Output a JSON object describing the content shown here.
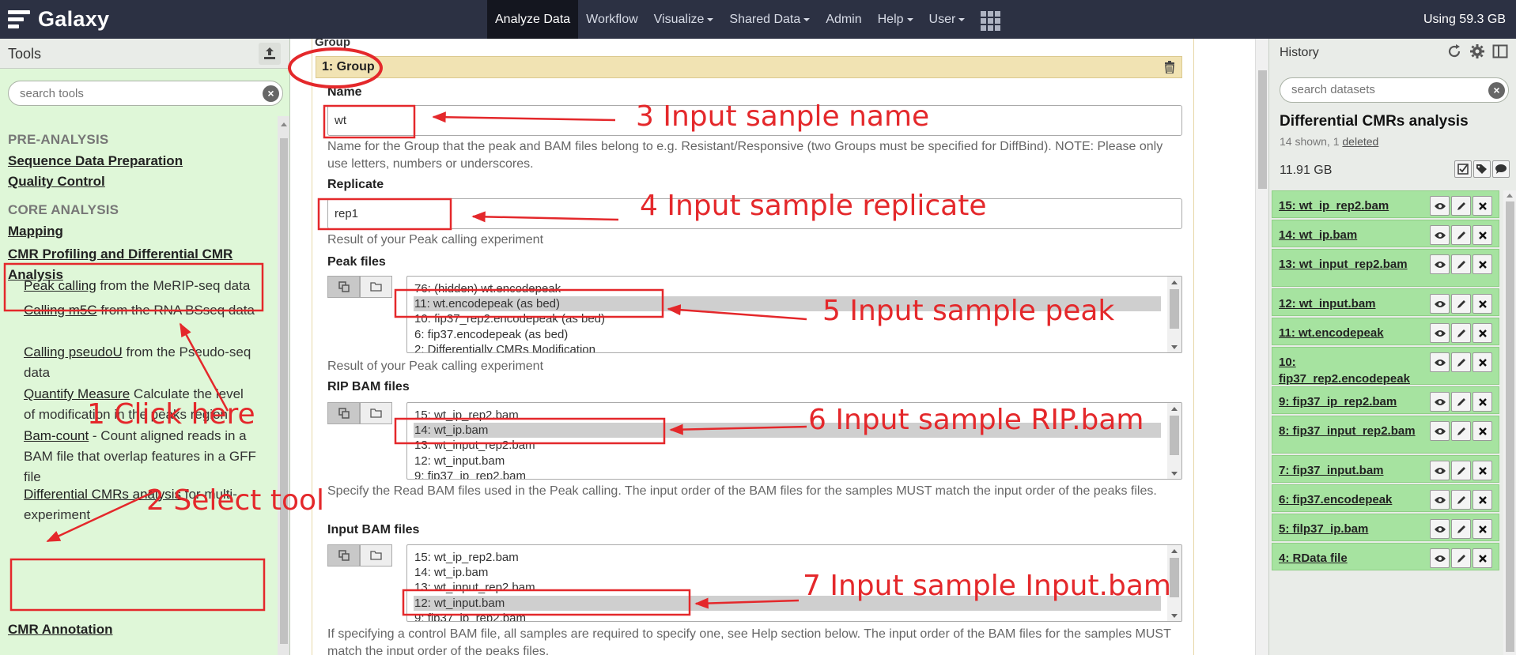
{
  "masthead": {
    "brand": "Galaxy",
    "nav": [
      {
        "label": "Analyze Data",
        "dropdown": false,
        "active": true
      },
      {
        "label": "Workflow",
        "dropdown": false,
        "active": false
      },
      {
        "label": "Visualize",
        "dropdown": true,
        "active": false
      },
      {
        "label": "Shared Data",
        "dropdown": true,
        "active": false
      },
      {
        "label": "Admin",
        "dropdown": false,
        "active": false
      },
      {
        "label": "Help",
        "dropdown": true,
        "active": false
      },
      {
        "label": "User",
        "dropdown": true,
        "active": false
      }
    ],
    "quota": "Using 59.3 GB"
  },
  "tools": {
    "title": "Tools",
    "search_placeholder": "search tools",
    "pre_analysis_header": "PRE-ANALYSIS",
    "sequence_data_prep": "Sequence Data Preparation",
    "quality_control": "Quality Control",
    "core_analysis_header": "CORE ANALYSIS",
    "mapping": "Mapping",
    "cmr_profiling": "CMR Profiling and Differential CMR Analysis",
    "items": [
      {
        "link": "Peak calling",
        "desc": " from the MeRIP-seq data"
      },
      {
        "link": "Calling m5C",
        "desc": " from the RNA BSseq data"
      },
      {
        "link": "Calling pseudoU",
        "desc": " from the Pseudo-seq data"
      },
      {
        "link": "Quantify Measure",
        "desc": " Calculate the level of modification in the peaks region"
      },
      {
        "link": "Bam-count",
        "desc": " - Count aligned reads in a BAM file that overlap features in a GFF file"
      },
      {
        "link": "Differential CMRs analysis",
        "desc": " for multi-experiment"
      }
    ],
    "cmr_annotation": "CMR Annotation"
  },
  "form": {
    "group_section_label": "Group",
    "group_title": "1: Group",
    "name_label": "Name",
    "name_value": "wt",
    "name_help": "Name for the Group that the peak and BAM files belong to e.g. Resistant/Responsive (two Groups must be specified for DiffBind). NOTE: Please only use letters, numbers or underscores.",
    "replicate_label": "Replicate",
    "replicate_value": "rep1",
    "replicate_help": "Result of your Peak calling experiment",
    "peak_label": "Peak files",
    "peak_options": [
      "76: (hidden) wt.encodepeak",
      "11: wt.encodepeak (as bed)",
      "10: fip37_rep2.encodepeak (as bed)",
      "6: fip37.encodepeak (as bed)",
      "2: Differentially CMRs Modification"
    ],
    "peak_selected_index": 1,
    "peak_help": "Result of your Peak calling experiment",
    "rip_label": "RIP BAM files",
    "rip_options": [
      "15: wt_ip_rep2.bam",
      "14: wt_ip.bam",
      "13: wt_input_rep2.bam",
      "12: wt_input.bam",
      "9: fip37_ip_rep2.bam"
    ],
    "rip_selected_index": 1,
    "rip_help": "Specify the Read BAM files used in the Peak calling. The input order of the BAM files for the samples MUST match the input order of the peaks files.",
    "input_label": "Input BAM files",
    "input_options": [
      "15: wt_ip_rep2.bam",
      "14: wt_ip.bam",
      "13: wt_input_rep2.bam",
      "12: wt_input.bam",
      "9: fip37_ip_rep2.bam"
    ],
    "input_selected_index": 3,
    "input_help": "If specifying a control BAM file, all samples are required to specify one, see Help section below. The input order of the BAM files for the samples MUST match the input order of the peaks files."
  },
  "history": {
    "title": "History",
    "search_placeholder": "search datasets",
    "name": "Differential CMRs analysis",
    "shown_prefix": "14 shown, 1 ",
    "deleted_link": "deleted",
    "size": "11.91 GB",
    "datasets": [
      "15: wt_ip_rep2.bam",
      "14: wt_ip.bam",
      "13: wt_input_rep2.bam",
      "12: wt_input.bam",
      "11: wt.encodepeak",
      "10: fip37_rep2.encodepeak",
      "9: fip37_ip_rep2.bam",
      "8: fip37_input_rep2.bam",
      "7: fip37_input.bam",
      "6: fip37.encodepeak",
      "5: filp37_ip.bam",
      "4: RData file"
    ]
  },
  "annotations": {
    "step1": "1 Click here",
    "step2": "2 Select tool",
    "step3": "3 Input sanple name",
    "step4": "4 Input sample replicate",
    "step5": "5 Input sample peak",
    "step6": "6 Input sample RIP.bam",
    "step7": "7 Input sample Input.bam",
    "color": "#e4282b"
  },
  "colors": {
    "masthead": "#2c3143",
    "tool_panel": "#dff7d8",
    "group_bar": "#f1e3b3",
    "dataset_ok": "#a6e3a0",
    "annotation": "#e4282b"
  }
}
